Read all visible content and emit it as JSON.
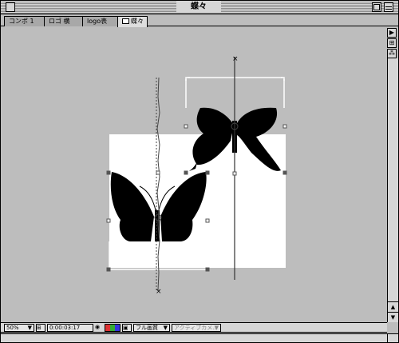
{
  "window": {
    "title": "蝶々"
  },
  "tabs": [
    {
      "label": "コンポ 1"
    },
    {
      "label": "ロゴ 横"
    },
    {
      "label": "logo表"
    },
    {
      "label": "蝶々"
    }
  ],
  "side_buttons": [
    "▶",
    "⊞",
    "⁂"
  ],
  "footer": {
    "zoom": "50%",
    "timecode": "0:00:03:17",
    "quality": "フル画質",
    "camera": "アクティブカメ..."
  },
  "colors": {
    "window_bg": "#bdbdbd",
    "comp_bg": "#ffffff",
    "butterfly": "#000000"
  }
}
